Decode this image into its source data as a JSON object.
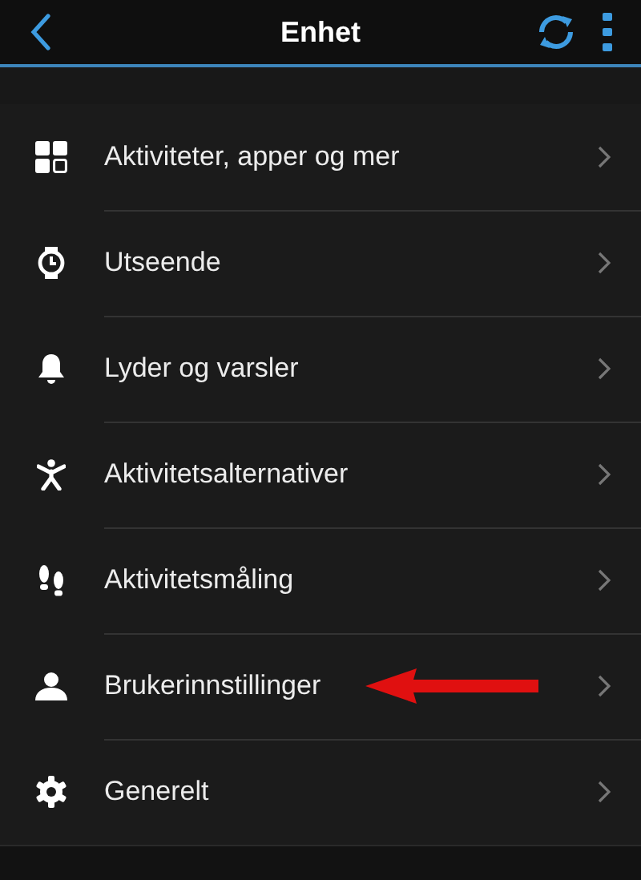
{
  "header": {
    "title": "Enhet"
  },
  "items": [
    {
      "label": "Aktiviteter, apper og mer",
      "marked": false
    },
    {
      "label": "Utseende",
      "marked": false
    },
    {
      "label": "Lyder og varsler",
      "marked": false
    },
    {
      "label": "Aktivitetsalternativer",
      "marked": false
    },
    {
      "label": "Aktivitetsmåling",
      "marked": false
    },
    {
      "label": "Brukerinnstillinger",
      "marked": true
    },
    {
      "label": "Generelt",
      "marked": false
    }
  ]
}
